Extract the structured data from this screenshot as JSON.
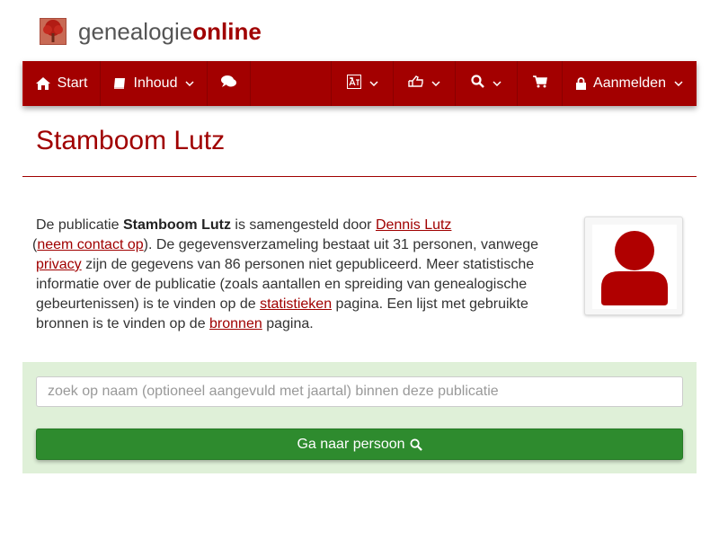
{
  "brand": {
    "part1": "genealogie",
    "part2": "online"
  },
  "nav": {
    "start_label": "Start",
    "inhoud_label": "Inhoud",
    "login_label": "Aanmelden"
  },
  "page": {
    "title": "Stamboom Lutz"
  },
  "intro": {
    "t1": "De publicatie ",
    "pub_name": "Stamboom Lutz",
    "t2": " is samengesteld door ",
    "author_link": "Dennis Lutz",
    "t3": " (",
    "contact_link": "neem contact op",
    "t4": "). De gegevensverzameling bestaat uit 31 personen, vanwege ",
    "privacy_link": "privacy",
    "t5": " zijn de gegevens van 86 personen niet gepubliceerd. Meer statistische informatie over de publicatie (zoals aantallen en spreiding van genealogische gebeurtenissen) is te vinden op de ",
    "stats_link": "statistieken",
    "t6": " pagina. Een lijst met gebruikte bronnen is te vinden op de ",
    "sources_link": "bronnen",
    "t7": " pagina."
  },
  "search": {
    "placeholder": "zoek op naam (optioneel aangevuld met jaartal) binnen deze publicatie",
    "button_label": "Ga naar persoon"
  },
  "colors": {
    "brand_red": "#a30000",
    "success_green": "#2e8b2e",
    "panel_green": "#dff0d8"
  },
  "icons": [
    "tree-logo-icon",
    "home-icon",
    "book-icon",
    "chevron-down-icon",
    "comments-icon",
    "language-icon",
    "hand-pointer-icon",
    "search-icon",
    "cart-icon",
    "lock-icon",
    "person-avatar-icon"
  ]
}
